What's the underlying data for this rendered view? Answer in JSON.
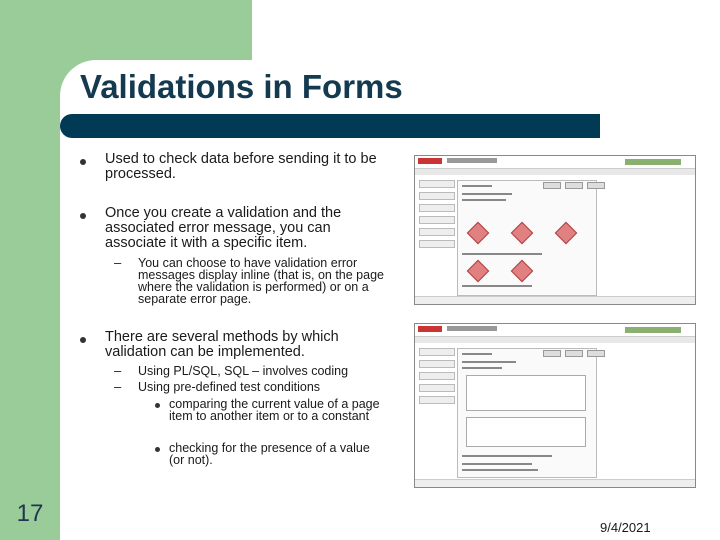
{
  "slide": {
    "title": "Validations in Forms",
    "number": "17",
    "date": "9/4/2021"
  },
  "bullets": [
    {
      "text": "Used to check data before sending it to be processed."
    },
    {
      "text": "Once you create a validation and the associated error message, you can associate it with a specific item."
    },
    {
      "text": "There are several methods by which validation can be implemented."
    }
  ],
  "sub_bullets": {
    "error_display": "You can choose to have validation error messages display inline (that is, on the page where the validation is performed) or on a separate error page.",
    "plsql": "Using PL/SQL, SQL – involves coding",
    "predefined": "Using pre-defined test conditions",
    "condition_compare": "comparing the current value of a page item to another item or to a constant",
    "condition_presence": "checking for the presence of a value (or not)."
  },
  "marker": {
    "dash": "–"
  },
  "colors": {
    "green_block": "#99cc99",
    "title_bar": "#003a55",
    "title_text": "#143a4f"
  }
}
